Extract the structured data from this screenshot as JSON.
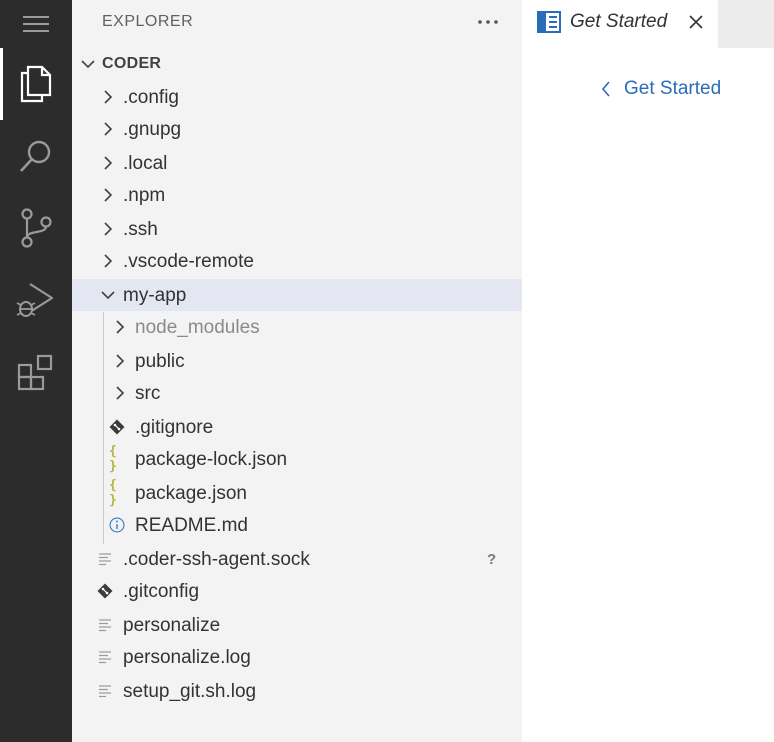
{
  "activity_bar": {
    "items": [
      {
        "name": "explorer",
        "icon": "files-icon",
        "active": true
      },
      {
        "name": "search",
        "icon": "search-icon",
        "active": false
      },
      {
        "name": "source-control",
        "icon": "source-control-icon",
        "active": false
      },
      {
        "name": "run-debug",
        "icon": "run-debug-icon",
        "active": false
      },
      {
        "name": "extensions",
        "icon": "extensions-icon",
        "active": false
      }
    ]
  },
  "sidebar": {
    "title": "EXPLORER",
    "more_icon": "ellipsis-icon",
    "section_title": "CODER",
    "tree": [
      {
        "label": ".config",
        "kind": "folder",
        "expanded": false
      },
      {
        "label": ".gnupg",
        "kind": "folder",
        "expanded": false
      },
      {
        "label": ".local",
        "kind": "folder",
        "expanded": false
      },
      {
        "label": ".npm",
        "kind": "folder",
        "expanded": false
      },
      {
        "label": ".ssh",
        "kind": "folder",
        "expanded": false
      },
      {
        "label": ".vscode-remote",
        "kind": "folder",
        "expanded": false
      },
      {
        "label": "my-app",
        "kind": "folder",
        "expanded": true,
        "selected": true
      },
      {
        "label": "node_modules",
        "kind": "folder",
        "expanded": false,
        "dimmed": true
      },
      {
        "label": "public",
        "kind": "folder",
        "expanded": false
      },
      {
        "label": "src",
        "kind": "folder",
        "expanded": false
      },
      {
        "label": ".gitignore",
        "kind": "git-file"
      },
      {
        "label": "package-lock.json",
        "kind": "json-file",
        "icon_text": "{ }"
      },
      {
        "label": "package.json",
        "kind": "json-file",
        "icon_text": "{ }"
      },
      {
        "label": "README.md",
        "kind": "info-file"
      },
      {
        "label": ".coder-ssh-agent.sock",
        "kind": "text-file",
        "badge": "?"
      },
      {
        "label": ".gitconfig",
        "kind": "git-file"
      },
      {
        "label": "personalize",
        "kind": "text-file"
      },
      {
        "label": "personalize.log",
        "kind": "text-file"
      },
      {
        "label": "setup_git.sh.log",
        "kind": "text-file"
      }
    ]
  },
  "editor": {
    "tabs": [
      {
        "label": "Get Started",
        "icon": "getting-started-icon",
        "italic": true
      }
    ],
    "back_link": "Get Started"
  },
  "colors": {
    "activity_bar_bg": "#2c2c2c",
    "sidebar_bg": "#f3f3f3",
    "selection_bg": "#e4e6f1",
    "link": "#2b6cb8",
    "tab_icon": "#2b6cb8",
    "json_icon": "#b5b53a"
  }
}
